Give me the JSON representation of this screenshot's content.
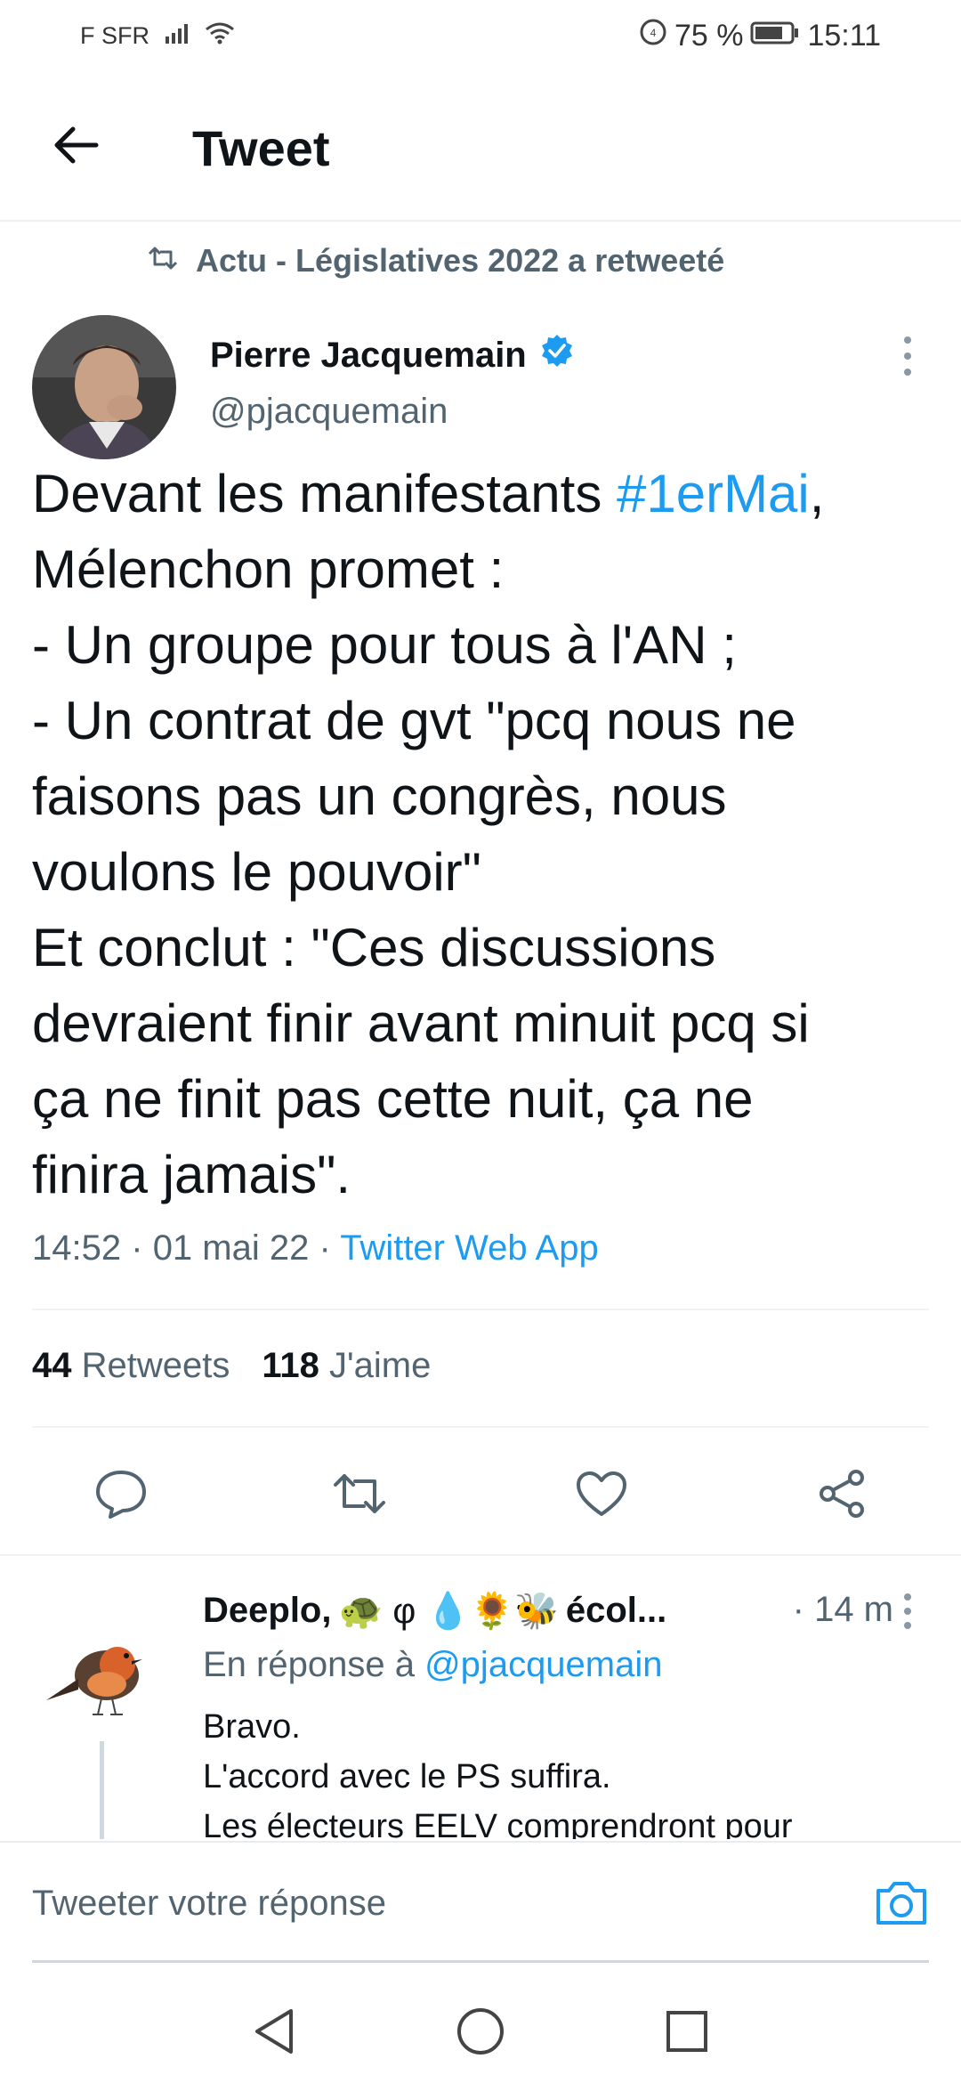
{
  "status_bar": {
    "carrier": "F SFR",
    "battery": "75 %",
    "time": "15:11"
  },
  "header": {
    "title": "Tweet"
  },
  "retweet_context": {
    "label": "Actu - Législatives 2022 a retweeté"
  },
  "tweet": {
    "author_name": "Pierre Jacquemain",
    "author_handle": "@pjacquemain",
    "text_before_hashtag": "Devant les manifestants ",
    "hashtag": "#1erMai",
    "text_after_hashtag": ",",
    "lines": [
      "Mélenchon promet :",
      "- Un groupe pour tous à l'AN ;",
      "- Un contrat de gvt \"pcq nous ne",
      "faisons pas un congrès, nous",
      "voulons le pouvoir\"",
      "Et conclut : \"Ces discussions",
      "devraient finir avant minuit pcq si",
      "ça ne finit pas cette nuit, ça ne",
      "finira jamais\"."
    ],
    "time": "14:52",
    "date": "01 mai 22",
    "separator": "·",
    "source": "Twitter Web App",
    "retweets_count": "44",
    "retweets_label": "Retweets",
    "likes_count": "118",
    "likes_label": "J'aime"
  },
  "reply": {
    "name": "Deeplo,",
    "name_emojis": "🐢 φ 💧🌻🐝",
    "name_suffix": "écol...",
    "time": "· 14 m",
    "reply_to_label": "En réponse à",
    "reply_to_handle": "@pjacquemain",
    "lines": [
      "Bravo.",
      "L'accord avec le PS suffira.",
      "Les électeurs EELV comprendront pour"
    ]
  },
  "composer": {
    "placeholder": "Tweeter votre réponse"
  },
  "icons": {
    "back": "arrow-left-icon",
    "retweet_context": "retweet-icon",
    "verified": "verified-badge-icon",
    "reply": "reply-icon",
    "retweet": "retweet-icon",
    "like": "heart-icon",
    "share": "share-icon",
    "camera": "camera-icon"
  },
  "colors": {
    "accent": "#1d9bf0",
    "text": "#0f1419",
    "secondary": "#536471"
  }
}
